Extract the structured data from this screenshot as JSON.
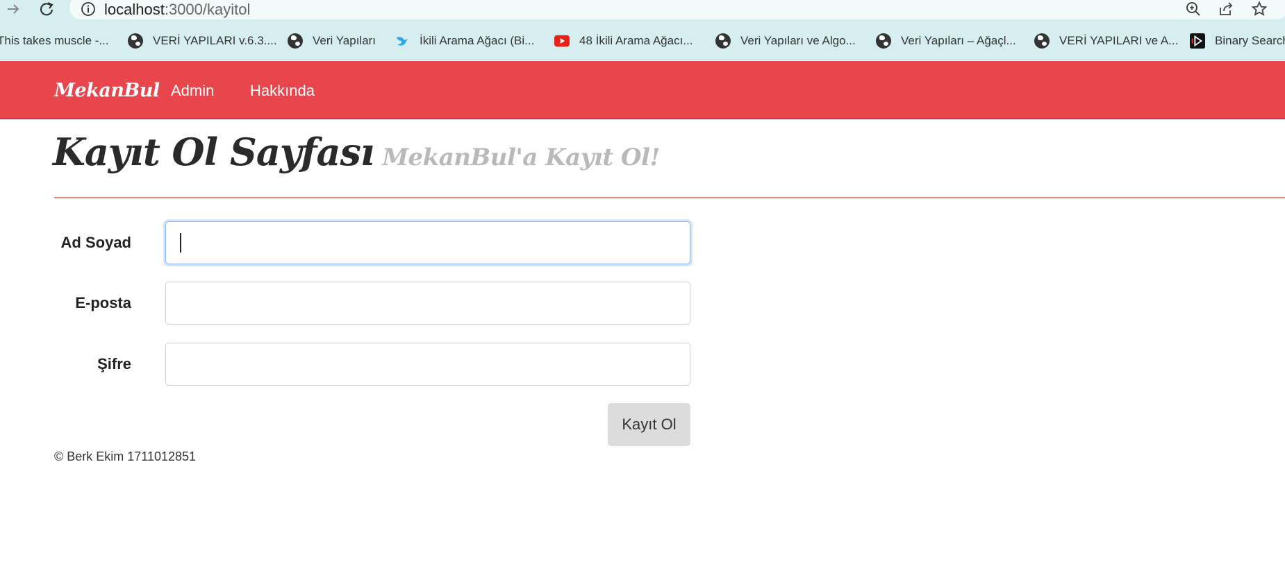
{
  "browser": {
    "url_host": "localhost",
    "url_path": ":3000/kayitol",
    "bookmarks": [
      {
        "label": "This takes muscle -...",
        "icon": "none"
      },
      {
        "label": "VERİ YAPILARI v.6.3....",
        "icon": "globe-icon"
      },
      {
        "label": "Veri Yapıları",
        "icon": "globe-icon"
      },
      {
        "label": "İkili Arama Ağacı (Bi...",
        "icon": "blue-bird-icon"
      },
      {
        "label": "48 İkili Arama Ağacı...",
        "icon": "youtube-icon"
      },
      {
        "label": "Veri Yapıları ve Algo...",
        "icon": "globe-icon"
      },
      {
        "label": "Veri Yapıları – Ağaçl...",
        "icon": "globe-icon"
      },
      {
        "label": "VERİ YAPILARI ve A...",
        "icon": "globe-icon"
      },
      {
        "label": "Binary Search",
        "icon": "play-logo-icon"
      }
    ]
  },
  "navbar": {
    "brand": "MekanBul",
    "links": [
      "Admin",
      "Hakkında"
    ],
    "color": "#e9454c"
  },
  "header": {
    "title": "Kayıt Ol Sayfası",
    "subtitle": "MekanBul'a Kayıt Ol!"
  },
  "form": {
    "fields": [
      {
        "label": "Ad Soyad",
        "value": "",
        "focused": true
      },
      {
        "label": "E-posta",
        "value": "",
        "focused": false
      },
      {
        "label": "Şifre",
        "value": "",
        "focused": false
      }
    ],
    "submit_label": "Kayıt Ol"
  },
  "footer": {
    "text": "© Berk Ekim 1711012851"
  }
}
